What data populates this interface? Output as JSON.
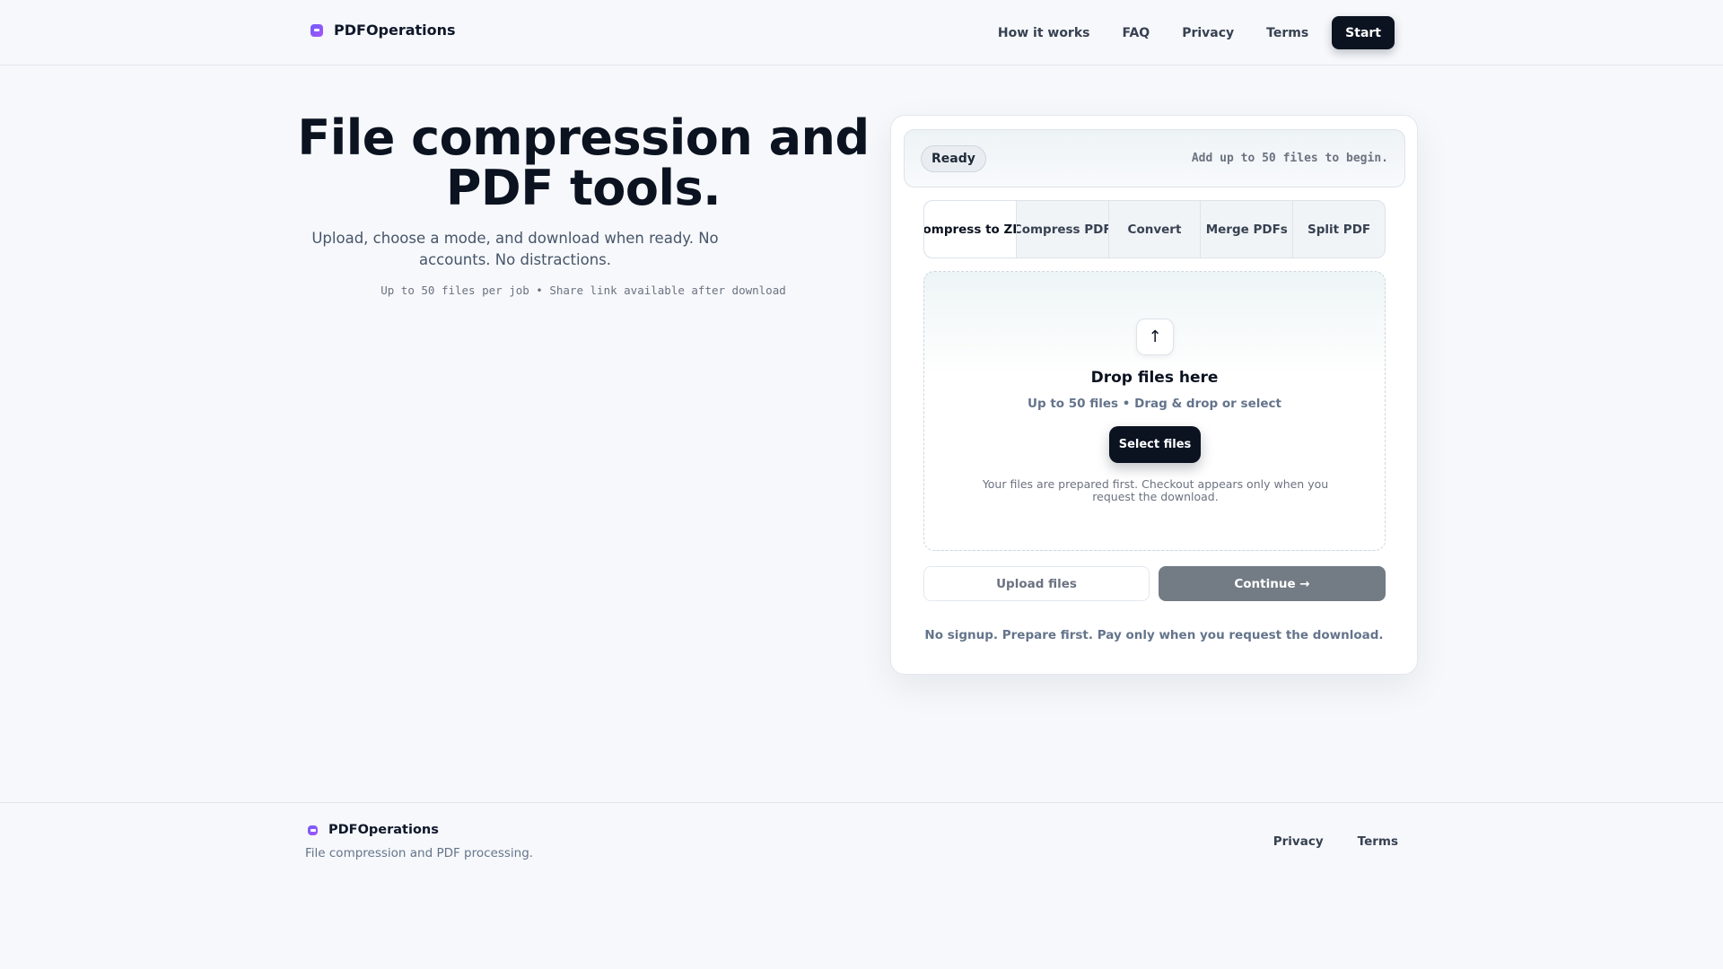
{
  "header": {
    "brand": "PDFOperations",
    "logo_icon": "pdf-logo-icon",
    "nav": [
      "How it works",
      "FAQ",
      "Privacy",
      "Terms"
    ],
    "start_label": "Start"
  },
  "hero": {
    "title": "File compression and PDF tools.",
    "subtitle": "Upload, choose a mode, and download when ready. No accounts. No distractions.",
    "meta": "Up to 50 files per job • Share link available after download"
  },
  "card": {
    "status_badge": "Ready",
    "status_message": "Add up to 50 files to begin.",
    "tabs": [
      "Compress to ZIP",
      "Compress PDF",
      "Convert",
      "Merge PDFs",
      "Split PDF"
    ],
    "active_tab": "Compress to ZIP",
    "dropzone": {
      "icon": "upload-arrow-icon",
      "title": "Drop files here",
      "subtitle": "Up to 50 files • Drag & drop or select",
      "select_label": "Select files",
      "note": "Your files are prepared first. Checkout appears only when you request the download."
    },
    "upload_label": "Upload files",
    "continue_label": "Continue →",
    "footnote": "No signup. Prepare first. Pay only when you request the download."
  },
  "footer": {
    "brand": "PDFOperations",
    "tagline": "File compression and PDF processing.",
    "links": [
      "Privacy",
      "Terms"
    ]
  },
  "colors": {
    "background": "#f6f8fb",
    "primary_dark": "#0b1220",
    "brand_accent": "#6d5dfc",
    "continue_disabled": "#737b85"
  }
}
